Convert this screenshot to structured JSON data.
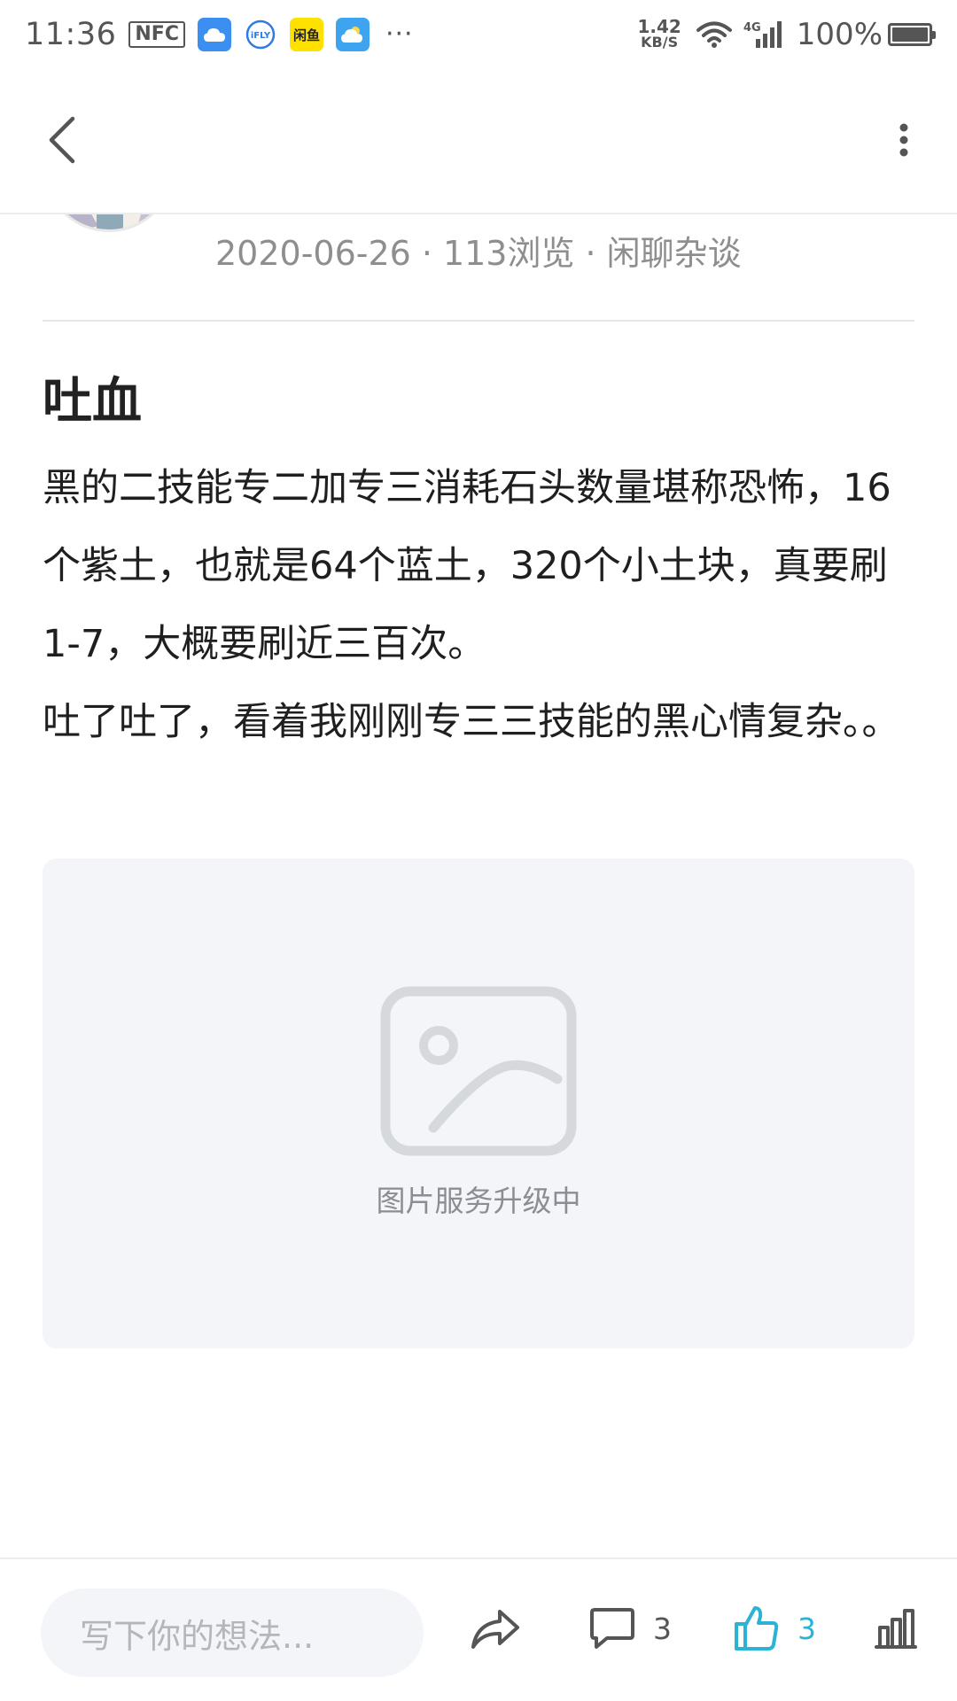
{
  "status_bar": {
    "time": "11:36",
    "nfc": "NFC",
    "xianyu": "闲鱼",
    "more": "···",
    "speed_value": "1.42",
    "speed_unit": "KB/S",
    "network": "4G",
    "battery": "100%",
    "battery_level": 1.0
  },
  "nav": {
    "back_icon": "chevron-left-icon",
    "more_icon": "vertical-dots-icon"
  },
  "post": {
    "date": "2020-06-26",
    "views": "113浏览",
    "category": "闲聊杂谈",
    "separator": "·",
    "title": "吐血",
    "body_paragraph_1": "黑的二技能专二加专三消耗石头数量堪称恐怖，16个紫土，也就是64个蓝土，320个小土块，真要刷1-7，大概要刷近三百次。",
    "body_paragraph_2": "吐了吐了，看着我刚刚专三三技能的黑心情复杂。。",
    "image_placeholder_text": "图片服务升级中"
  },
  "bottom_bar": {
    "input_placeholder": "写下你的想法...",
    "comment_count": "3",
    "like_count": "3"
  },
  "colors": {
    "accent": "#2bb3d6",
    "meta_text": "#8e8e8e",
    "placeholder_bg": "#f4f5f8"
  }
}
